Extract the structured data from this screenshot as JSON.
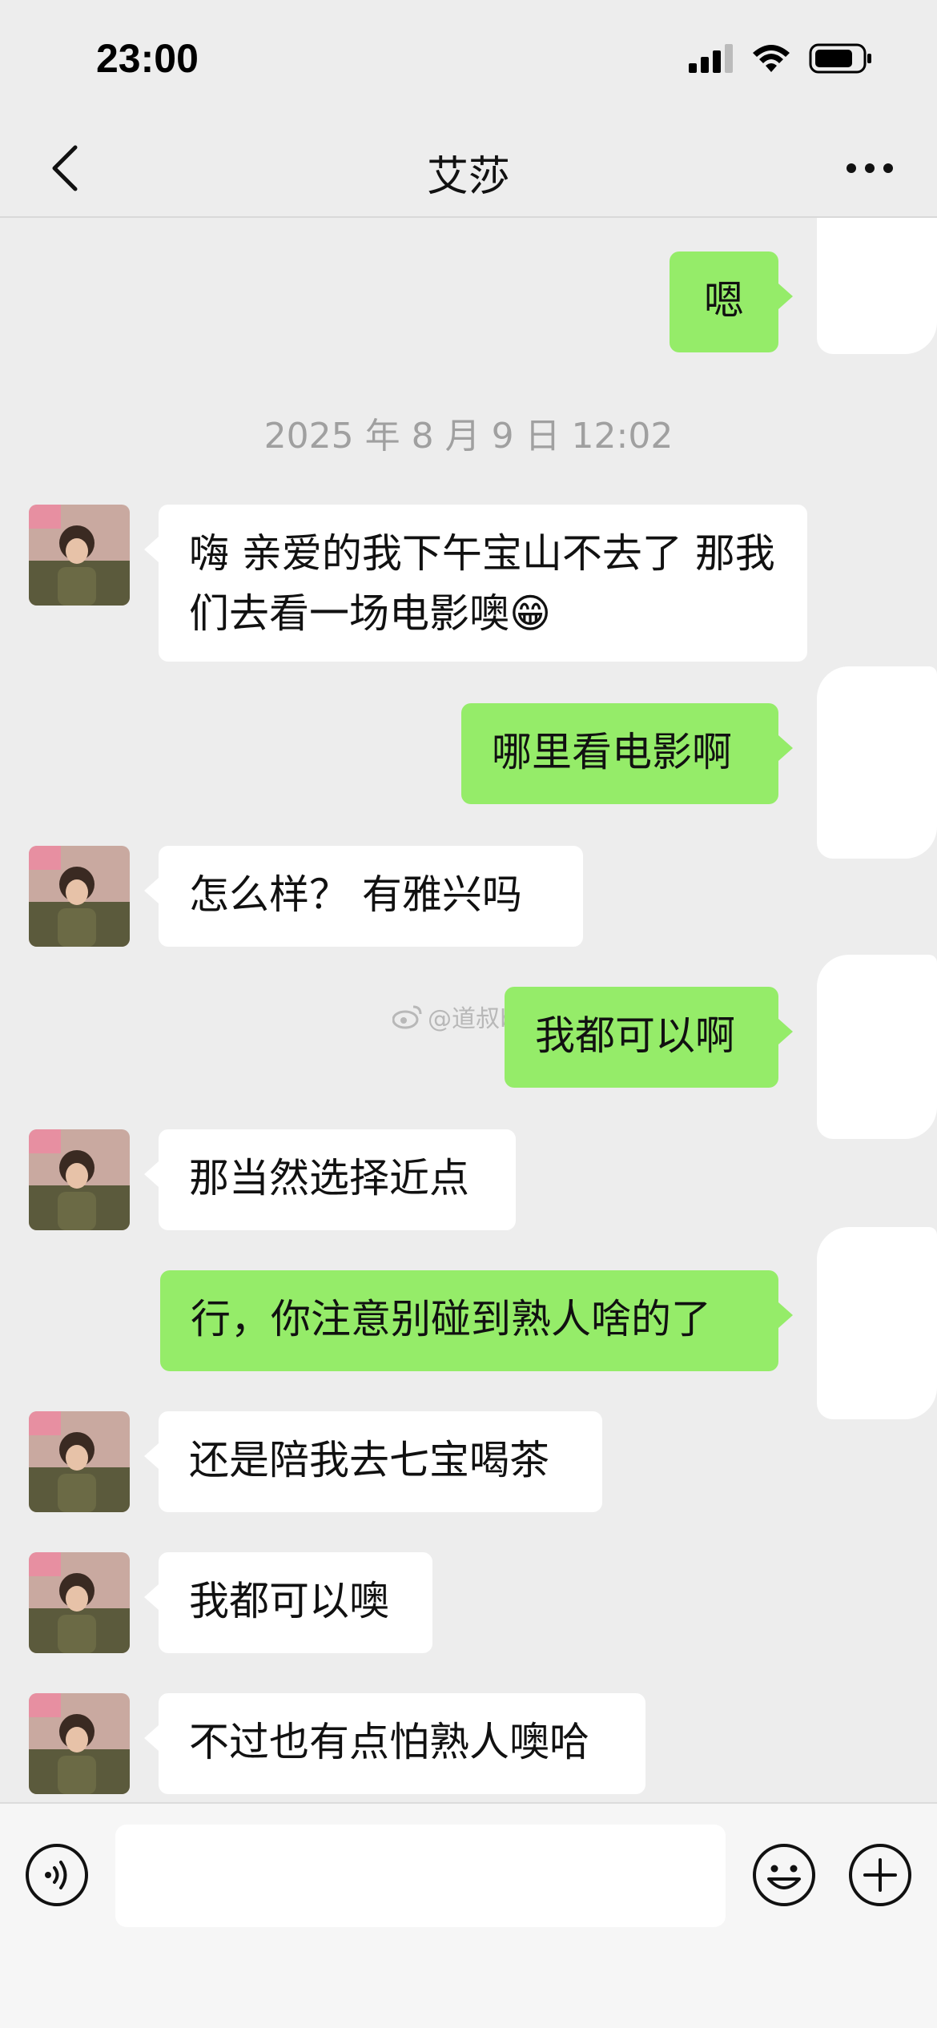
{
  "status_bar": {
    "time": "23:00"
  },
  "nav": {
    "title": "艾莎"
  },
  "watermark": "@道叔bot",
  "messages": [
    {
      "dir": "out",
      "text": "嗯"
    },
    {
      "timestamp": "2025 年 8 月 9 日 12:02"
    },
    {
      "dir": "in",
      "text": "嗨 亲爱的我下午宝山不去了  那我们去看一场电影噢😁"
    },
    {
      "dir": "out",
      "text": "哪里看电影啊"
    },
    {
      "dir": "in",
      "text": "怎么样？  有雅兴吗"
    },
    {
      "dir": "out",
      "text": "我都可以啊"
    },
    {
      "dir": "in",
      "text": "那当然选择近点"
    },
    {
      "dir": "out",
      "text": "行，你注意别碰到熟人啥的了"
    },
    {
      "dir": "in",
      "text": "还是陪我去七宝喝茶"
    },
    {
      "dir": "in",
      "text": "我都可以噢"
    },
    {
      "dir": "in",
      "text": "不过也有点怕熟人噢哈"
    }
  ],
  "input": {
    "value": ""
  },
  "colors": {
    "background": "#ededed",
    "outgoing_bubble": "#95ec69",
    "incoming_bubble": "#ffffff"
  },
  "icons": [
    "back-icon",
    "more-icon",
    "voice-icon",
    "emoji-icon",
    "plus-icon",
    "signal-icon",
    "wifi-icon",
    "battery-icon",
    "weibo-icon"
  ]
}
